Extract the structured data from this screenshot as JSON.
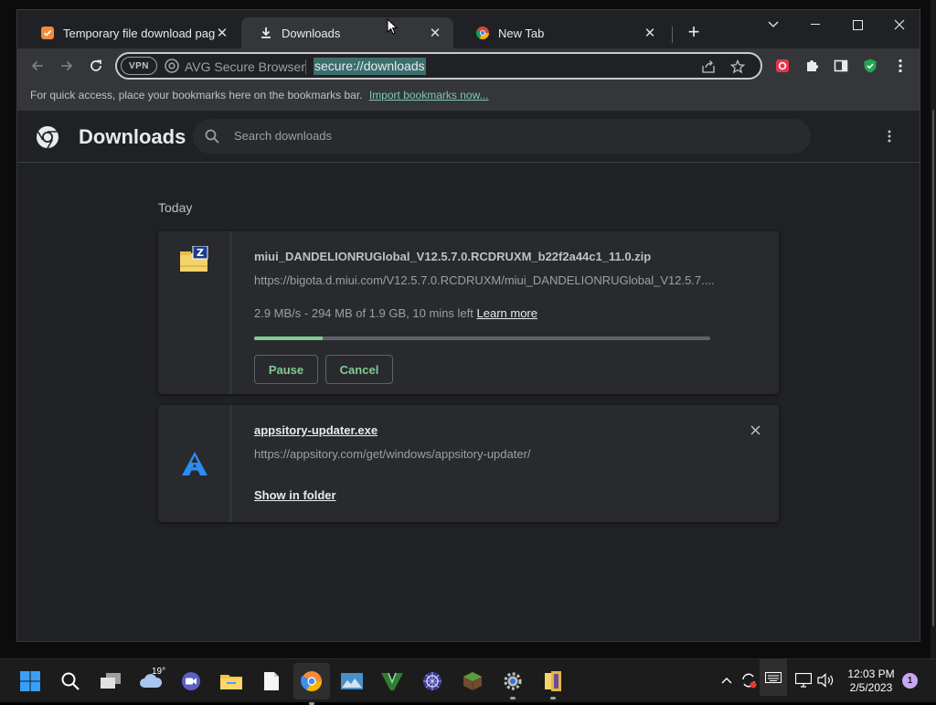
{
  "tabs": [
    {
      "title": "Temporary file download page",
      "icon": "avg-shield-icon"
    },
    {
      "title": "Downloads",
      "icon": "download-arrow-icon",
      "active": true
    },
    {
      "title": "New Tab",
      "icon": "chrome-icon"
    }
  ],
  "toolbar": {
    "vpn_label": "VPN",
    "brand_label": "AVG Secure Browser",
    "url": "secure://downloads"
  },
  "bookmarks_bar": {
    "message": "For quick access, place your bookmarks here on the bookmarks bar.",
    "import_link": "Import bookmarks now..."
  },
  "downloads_page": {
    "title": "Downloads",
    "search_placeholder": "Search downloads",
    "section_date": "Today",
    "items": [
      {
        "filename": "miui_DANDELIONRUGlobal_V12.5.7.0.RCDRUXM_b22f2a44c1_11.0.zip",
        "url": "https://bigota.d.miui.com/V12.5.7.0.RCDRUXM/miui_DANDELIONRUGlobal_V12.5.7....",
        "status": "2.9 MB/s - 294 MB of 1.9 GB, 10 mins left",
        "learn_more": "Learn more",
        "progress": 0.15,
        "pause_label": "Pause",
        "cancel_label": "Cancel",
        "icon": "zip-archive-icon"
      },
      {
        "filename": "appsitory-updater.exe",
        "url": "https://appsitory.com/get/windows/appsitory-updater/",
        "show_in_folder": "Show in folder",
        "icon": "appsitory-logo-icon"
      }
    ]
  },
  "taskbar": {
    "weather_temp": "19°",
    "clock_time": "12:03 PM",
    "clock_date": "2/5/2023",
    "notification_count": "1"
  },
  "colors": {
    "accent_green": "#81c995",
    "page_bg": "#202124",
    "card_bg": "#292a2d"
  }
}
